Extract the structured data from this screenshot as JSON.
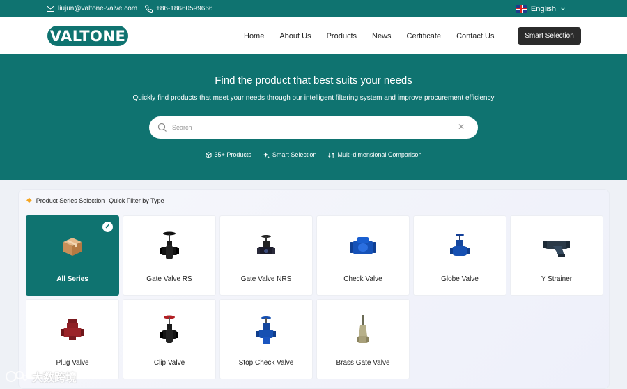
{
  "topbar": {
    "email": "liujun@valtone-valve.com",
    "phone": "+86-18660599666",
    "language": "English"
  },
  "header": {
    "logo": "VALTONE",
    "nav": [
      "Home",
      "About Us",
      "Products",
      "News",
      "Certificate",
      "Contact Us"
    ],
    "cta": "Smart Selection"
  },
  "hero": {
    "title": "Find the product that best suits your needs",
    "subtitle": "Quickly find products that meet your needs through our intelligent filtering system and improve procurement efficiency",
    "search_placeholder": "Search",
    "features": [
      {
        "icon": "cube-icon",
        "label": "35+ Products"
      },
      {
        "icon": "sparkle-icon",
        "label": "Smart Selection"
      },
      {
        "icon": "swap-icon",
        "label": "Multi-dimensional Comparison"
      }
    ]
  },
  "panel": {
    "title": "Product Series Selection",
    "subtitle": "Quick Filter by Type",
    "products": [
      {
        "label": "All Series",
        "icon": "box-icon",
        "active": true
      },
      {
        "label": "Gate Valve RS",
        "icon": "gate-valve-icon"
      },
      {
        "label": "Gate Valve NRS",
        "icon": "gate-valve-nrs-icon"
      },
      {
        "label": "Check Valve",
        "icon": "check-valve-icon"
      },
      {
        "label": "Globe Valve",
        "icon": "globe-valve-icon"
      },
      {
        "label": "Y Strainer",
        "icon": "y-strainer-icon"
      },
      {
        "label": "Plug Valve",
        "icon": "plug-valve-icon"
      },
      {
        "label": "Clip Valve",
        "icon": "clip-valve-icon"
      },
      {
        "label": "Stop Check Valve",
        "icon": "stop-check-valve-icon"
      },
      {
        "label": "Brass Gate Valve",
        "icon": "brass-gate-valve-icon"
      }
    ]
  },
  "watermark": "大数跨境",
  "colors": {
    "brand": "#0f7370",
    "cta": "#2b2b2b",
    "accent": "#f5a623"
  }
}
